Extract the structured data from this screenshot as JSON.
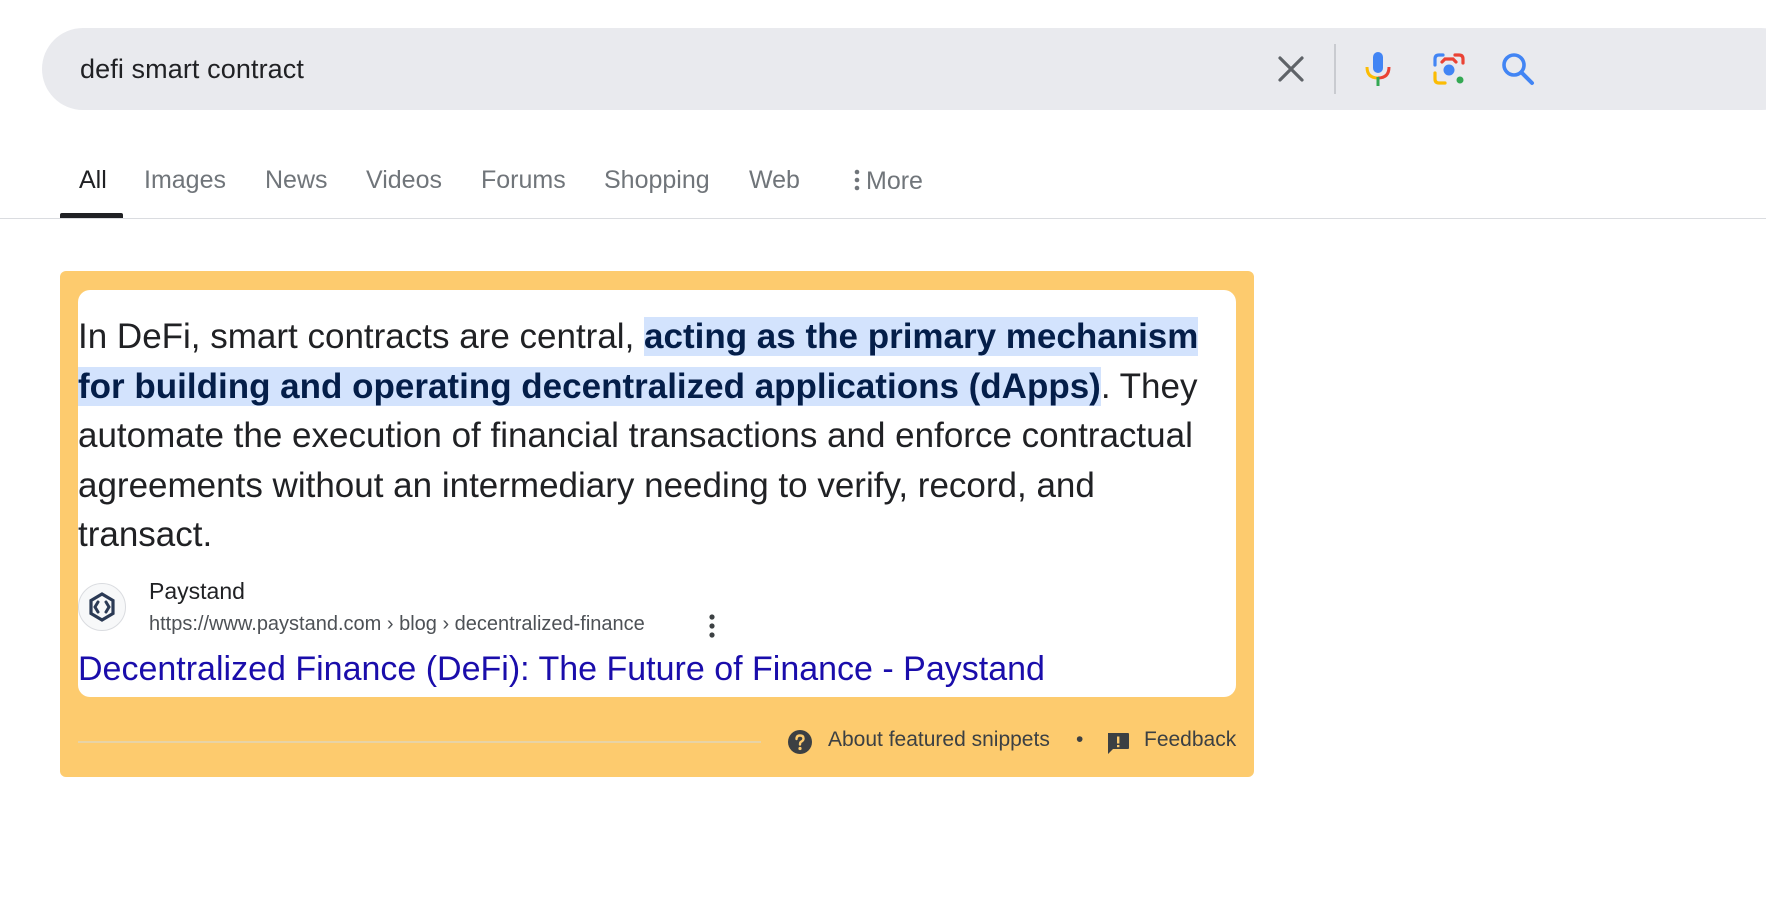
{
  "search": {
    "query": "defi smart contract",
    "icons": [
      "close-icon",
      "microphone-icon",
      "lens-camera-icon",
      "search-icon"
    ]
  },
  "tabs": [
    {
      "label": "All",
      "active": true
    },
    {
      "label": "Images",
      "active": false
    },
    {
      "label": "News",
      "active": false
    },
    {
      "label": "Videos",
      "active": false
    },
    {
      "label": "Forums",
      "active": false
    },
    {
      "label": "Shopping",
      "active": false
    },
    {
      "label": "Web",
      "active": false
    },
    {
      "label": "More",
      "active": false,
      "icon": "more-vert-icon"
    }
  ],
  "snippet": {
    "text_before": "In DeFi, smart contracts are central, ",
    "highlight": "acting as the primary mechanism for building and operating decentralized applications (dApps)",
    "text_after": ". They automate the execution of financial transactions and enforce contractual agreements without an intermediary needing to verify, record, and transact.",
    "source": {
      "name": "Paystand",
      "url": "https://www.paystand.com › blog › decentralized-finance",
      "favicon": "paystand-logo-icon"
    },
    "link_title": "Decentralized Finance (DeFi): The Future of Finance - Paystand"
  },
  "footer": {
    "about": "About featured snippets",
    "separator": "•",
    "feedback": "Feedback"
  },
  "colors": {
    "snippet_background": "#fdcb6e",
    "highlight_background": "#d3e3fd",
    "link": "#1a0dab",
    "search_bar": "#e9eaee"
  }
}
